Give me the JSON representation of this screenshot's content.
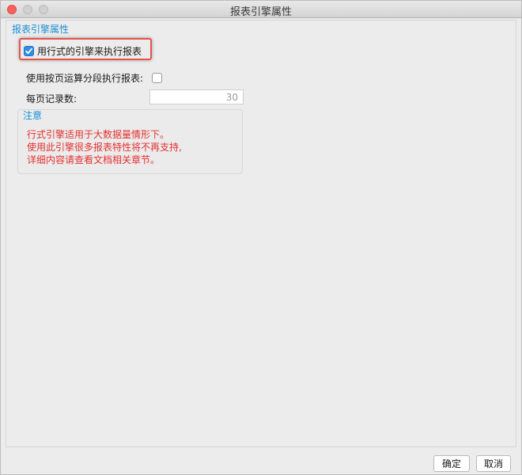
{
  "window": {
    "title": "报表引擎属性"
  },
  "section": {
    "title": "报表引擎属性"
  },
  "options": {
    "row_engine": {
      "label": "用行式的引擎来执行报表",
      "checked": true
    },
    "paged_exec": {
      "label": "使用按页运算分段执行报表:",
      "checked": false
    },
    "records_per_page": {
      "label": "每页记录数:",
      "value": "30"
    }
  },
  "note": {
    "title": "注意",
    "lines": [
      "行式引擎适用于大数据量情形下。",
      "使用此引擎很多报表特性将不再支持,",
      "详细内容请查看文档相关章节。"
    ]
  },
  "buttons": {
    "ok": "确定",
    "cancel": "取消"
  },
  "colors": {
    "accent": "#1a8fd6",
    "warning_text": "#e53030",
    "highlight": "#e5534b",
    "checkbox_checked": "#2e8ee6"
  },
  "icons": {
    "checked": "checkmark-icon"
  }
}
